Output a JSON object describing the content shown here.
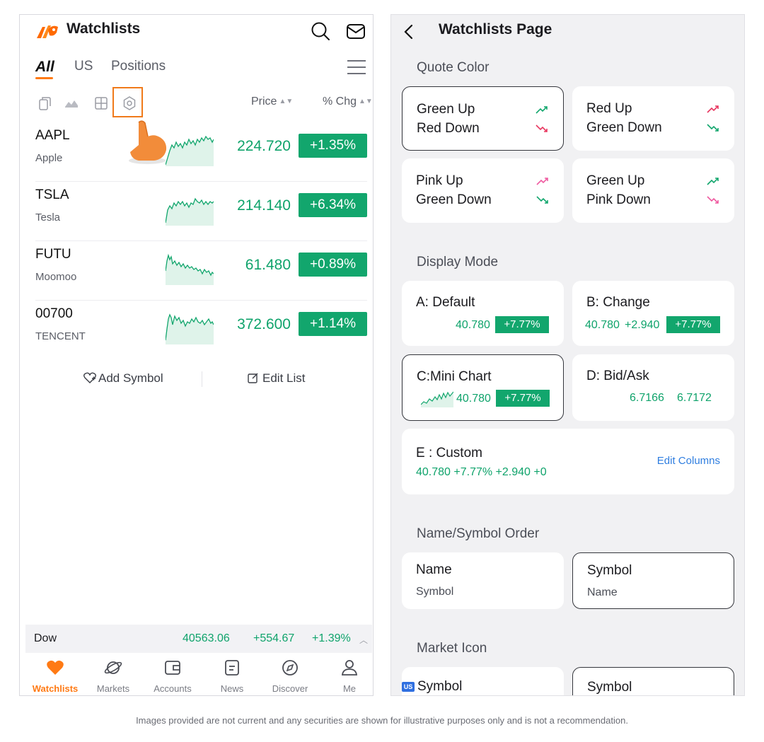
{
  "left": {
    "title": "Watchlists",
    "tabs": [
      "All",
      "US",
      "Positions"
    ],
    "columns": {
      "price": "Price",
      "chg": "% Chg"
    },
    "rows": [
      {
        "symbol": "AAPL",
        "name": "Apple",
        "price": "224.720",
        "chg": "+1.35%"
      },
      {
        "symbol": "TSLA",
        "name": "Tesla",
        "price": "214.140",
        "chg": "+6.34%"
      },
      {
        "symbol": "FUTU",
        "name": "Moomoo",
        "price": "61.480",
        "chg": "+0.89%"
      },
      {
        "symbol": "00700",
        "name": "TENCENT",
        "price": "372.600",
        "chg": "+1.14%"
      }
    ],
    "actions": {
      "add": "Add Symbol",
      "edit": "Edit List"
    },
    "ticker": {
      "name": "Dow",
      "value": "40563.06",
      "change": "+554.67",
      "pct": "+1.39%"
    },
    "nav": [
      "Watchlists",
      "Markets",
      "Accounts",
      "News",
      "Discover",
      "Me"
    ],
    "colors": {
      "accent": "#ff7a14",
      "up": "#12a66d",
      "down": "#e8365f"
    }
  },
  "right": {
    "title": "Watchlists Page",
    "quote_color": {
      "heading": "Quote Color",
      "options": [
        {
          "l1": "Green Up",
          "l2": "Red Down"
        },
        {
          "l1": "Red Up",
          "l2": "Green Down"
        },
        {
          "l1": "Pink Up",
          "l2": "Green Down"
        },
        {
          "l1": "Green Up",
          "l2": "Pink Down"
        }
      ]
    },
    "display_mode": {
      "heading": "Display Mode",
      "a": {
        "label": "A: Default",
        "price": "40.780",
        "badge": "+7.77%"
      },
      "b": {
        "label": "B: Change",
        "price": "40.780",
        "change": "+2.940",
        "badge": "+7.77%"
      },
      "c": {
        "label": "C:Mini Chart",
        "price": "40.780",
        "badge": "+7.77%"
      },
      "d": {
        "label": "D: Bid/Ask",
        "bid": "6.7166",
        "ask": "6.7172"
      },
      "e": {
        "label": "E : Custom",
        "values": "40.780 +7.77% +2.940 +0",
        "link": "Edit Columns"
      }
    },
    "order": {
      "heading": "Name/Symbol Order",
      "options": [
        {
          "l1": "Name",
          "l2": "Symbol"
        },
        {
          "l1": "Symbol",
          "l2": "Name"
        }
      ]
    },
    "market_icon": {
      "heading": "Market Icon",
      "badge": "US",
      "options": [
        "Symbol",
        "Symbol"
      ]
    }
  },
  "disclaimer": "Images provided are not current and any securities are shown for illustrative purposes only and is not a recommendation."
}
